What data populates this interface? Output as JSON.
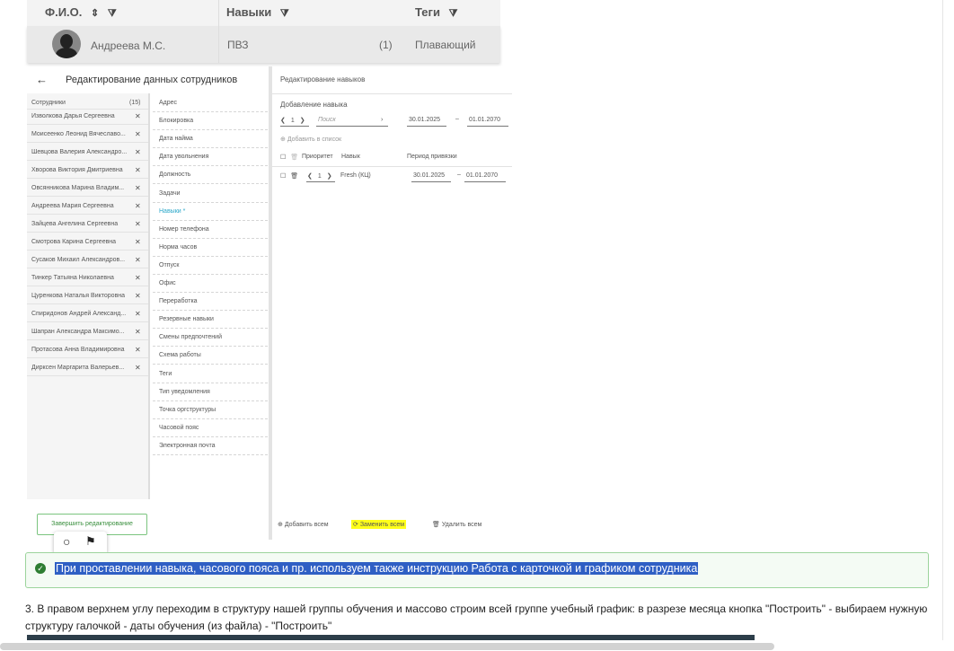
{
  "table": {
    "col_fio": "Ф.И.О.",
    "col_skills": "Навыки",
    "col_tags": "Теги",
    "row": {
      "name": "Андреева М.С.",
      "skill": "ПВЗ",
      "count": "(1)",
      "tag": "Плавающий"
    }
  },
  "editor": {
    "title": "Редактирование данных сотрудников",
    "employees_label": "Сотрудники",
    "employees_count": "(15)",
    "employees": [
      "Изволкова Дарья Сергеевна",
      "Моисеенко Леонид Вячеславо...",
      "Шевцова Валерия Александро...",
      "Хворова Виктория Дмитриевна",
      "Овсянникова Марина Владим...",
      "Андреева Мария Сергеевна",
      "Зайцева Ангелина Сергеевна",
      "Смотрова Карина Сергеевна",
      "Сусаков Михаил Александров...",
      "Тинкер Татьяна Николаевна",
      "Цуренкова Наталья Викторовна",
      "Спиридонов Андрей Александ...",
      "Шапран Александра Максимо...",
      "Протасова Анна Владимировна",
      "Дирксен Маргарита Валерьев..."
    ],
    "fields": [
      "Адрес",
      "Блокировка",
      "Дата найма",
      "Дата увольнения",
      "Должность",
      "Задачи",
      "Навыки *",
      "Номер телефона",
      "Норма часов",
      "Отпуск",
      "Офис",
      "Переработка",
      "Резервные навыки",
      "Смены предпочтений",
      "Схема работы",
      "Теги",
      "Тип уведомления",
      "Точка оргструктуры",
      "Часовой пояс",
      "Электронная почта"
    ],
    "active_field_index": 6,
    "finish_label": "Завершить редактирование",
    "skills_panel": {
      "title": "Редактирование навыков",
      "add_title": "Добавление навыка",
      "priority_value": "1",
      "search_placeholder": "Поиск",
      "date_from": "30.01.2025",
      "date_to": "01.01.2070",
      "add_to_list": "Добавить в список",
      "col_priority": "Приоритет",
      "col_skill": "Навык",
      "col_period": "Период привязки",
      "row": {
        "priority": "1",
        "skill": "Fresh (КЦ)",
        "date_from": "30.01.2025",
        "date_to": "01.01.2070"
      },
      "add_all": "Добавить всем",
      "replace_all": "Заменить всем",
      "delete_all": "Удалить всем"
    }
  },
  "callout": {
    "text": "При проставлении навыка, часового пояса и пр. используем также инструкцию Работа с карточкой и графиком сотрудника"
  },
  "paragraph": {
    "text": "3. В правом верхнем углу переходим в структуру нашей группы обучения и массово строим всей группе учебный график: в разрезе месяца кнопка \"Построить\" - выбираем нужную структуру галочкой - даты обучения (из файла) - \"Построить\""
  },
  "colors": {
    "accent": "#2f5fc4",
    "success": "#2e7d32",
    "highlight": "#ffff1a",
    "active_field": "#2aa7c9"
  }
}
